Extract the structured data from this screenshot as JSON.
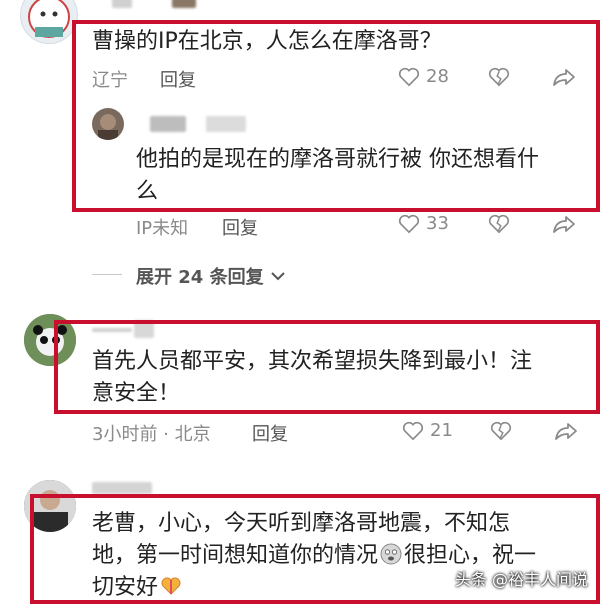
{
  "comments": [
    {
      "text": "曹操的IP在北京，人怎么在摩洛哥？",
      "location": "辽宁",
      "reply_label": "回复",
      "likes": "28"
    },
    {
      "text_line1": "他拍的是现在的摩洛哥就行被 你还想看什",
      "text_line2": "么",
      "location": "IP未知",
      "reply_label": "回复",
      "likes": "33"
    },
    {
      "expand_label": "展开 24 条回复"
    },
    {
      "text_line1": "首先人员都平安，其次希望损失降到最小！注",
      "text_line2": "意安全！",
      "location": "3小时前 · 北京",
      "reply_label": "回复",
      "likes": "21"
    },
    {
      "text_line1": "老曹，小心，今天听到摩洛哥地震，不知怎",
      "text_line2a": "地，第一时间想知道你的情况",
      "text_line2b": "很担心，祝一",
      "text_line3": "切安好"
    }
  ],
  "watermark": "头条 @裕丰人间说",
  "colors": {
    "highlight": "#c8102e",
    "meta": "#8a8a8a"
  },
  "icons": [
    "heart-icon",
    "broken-heart-icon",
    "share-icon",
    "chevron-down-icon",
    "fearful-face-emoji",
    "heart-gift-emoji"
  ]
}
